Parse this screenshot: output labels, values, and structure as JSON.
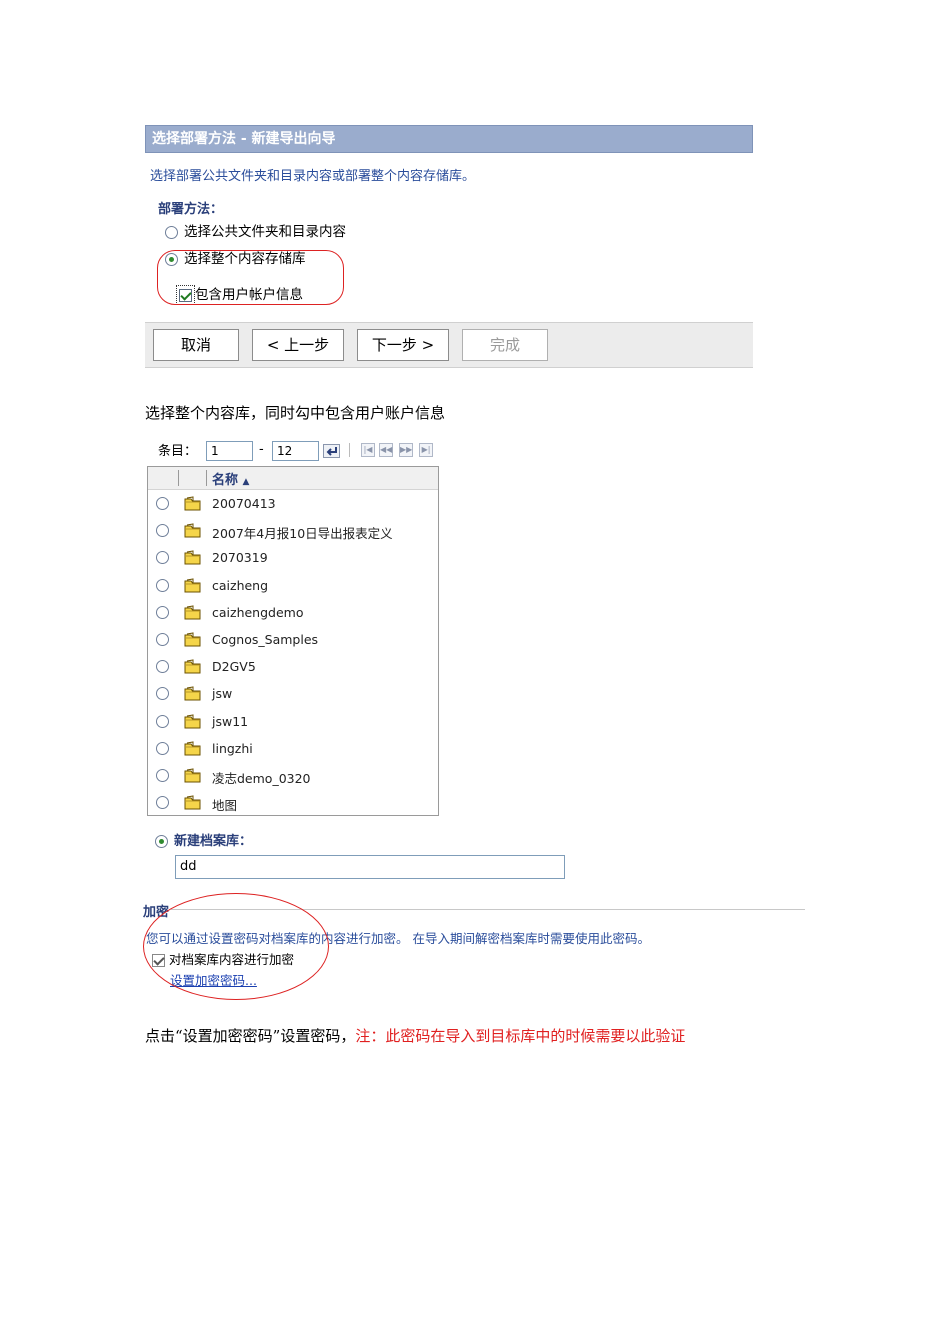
{
  "wizard": {
    "title": "选择部署方法 - 新建导出向导",
    "description": "选择部署公共文件夹和目录内容或部署整个内容存储库。",
    "method_label": "部署方法：",
    "option_public": "选择公共文件夹和目录内容",
    "option_entire": "选择整个内容存储库",
    "selected_option": "选择整个内容存储库",
    "include_accounts_label": "包含用户帐户信息",
    "include_accounts_checked": true,
    "buttons": {
      "cancel": "取消",
      "back": "< 上一步",
      "next": "下一步 >",
      "finish": "完成"
    }
  },
  "caption1": "选择整个内容库，同时勾中包含用户账户信息",
  "paging": {
    "label": "条目：",
    "from": "1",
    "dash": "-",
    "to": "12"
  },
  "list": {
    "column_name": "名称",
    "items": [
      "20070413",
      "2007年4月报10日导出报表定义",
      "2070319",
      "caizheng",
      "caizhengdemo",
      "Cognos_Samples",
      "D2GV5",
      "jsw",
      "jsw11",
      "lingzhi",
      "凌志demo_0320",
      "地图"
    ]
  },
  "new_archive": {
    "label": "新建档案库：",
    "value": "dd"
  },
  "encryption": {
    "title": "加密",
    "description": "您可以通过设置密码对档案库的内容进行加密。 在导入期间解密档案库时需要使用此密码。",
    "checkbox_label": "对档案库内容进行加密",
    "checkbox_checked": true,
    "link": "设置加密密码..."
  },
  "note": {
    "text": "点击“设置加密密码”设置密码，",
    "warning": "注：此密码在导入到目标库中的时候需要以此验证"
  },
  "colors": {
    "header_bg": "#9aaccd",
    "link_blue": "#1a3fb0",
    "annotation_red": "#dd2222",
    "warning_red": "#e02020"
  }
}
